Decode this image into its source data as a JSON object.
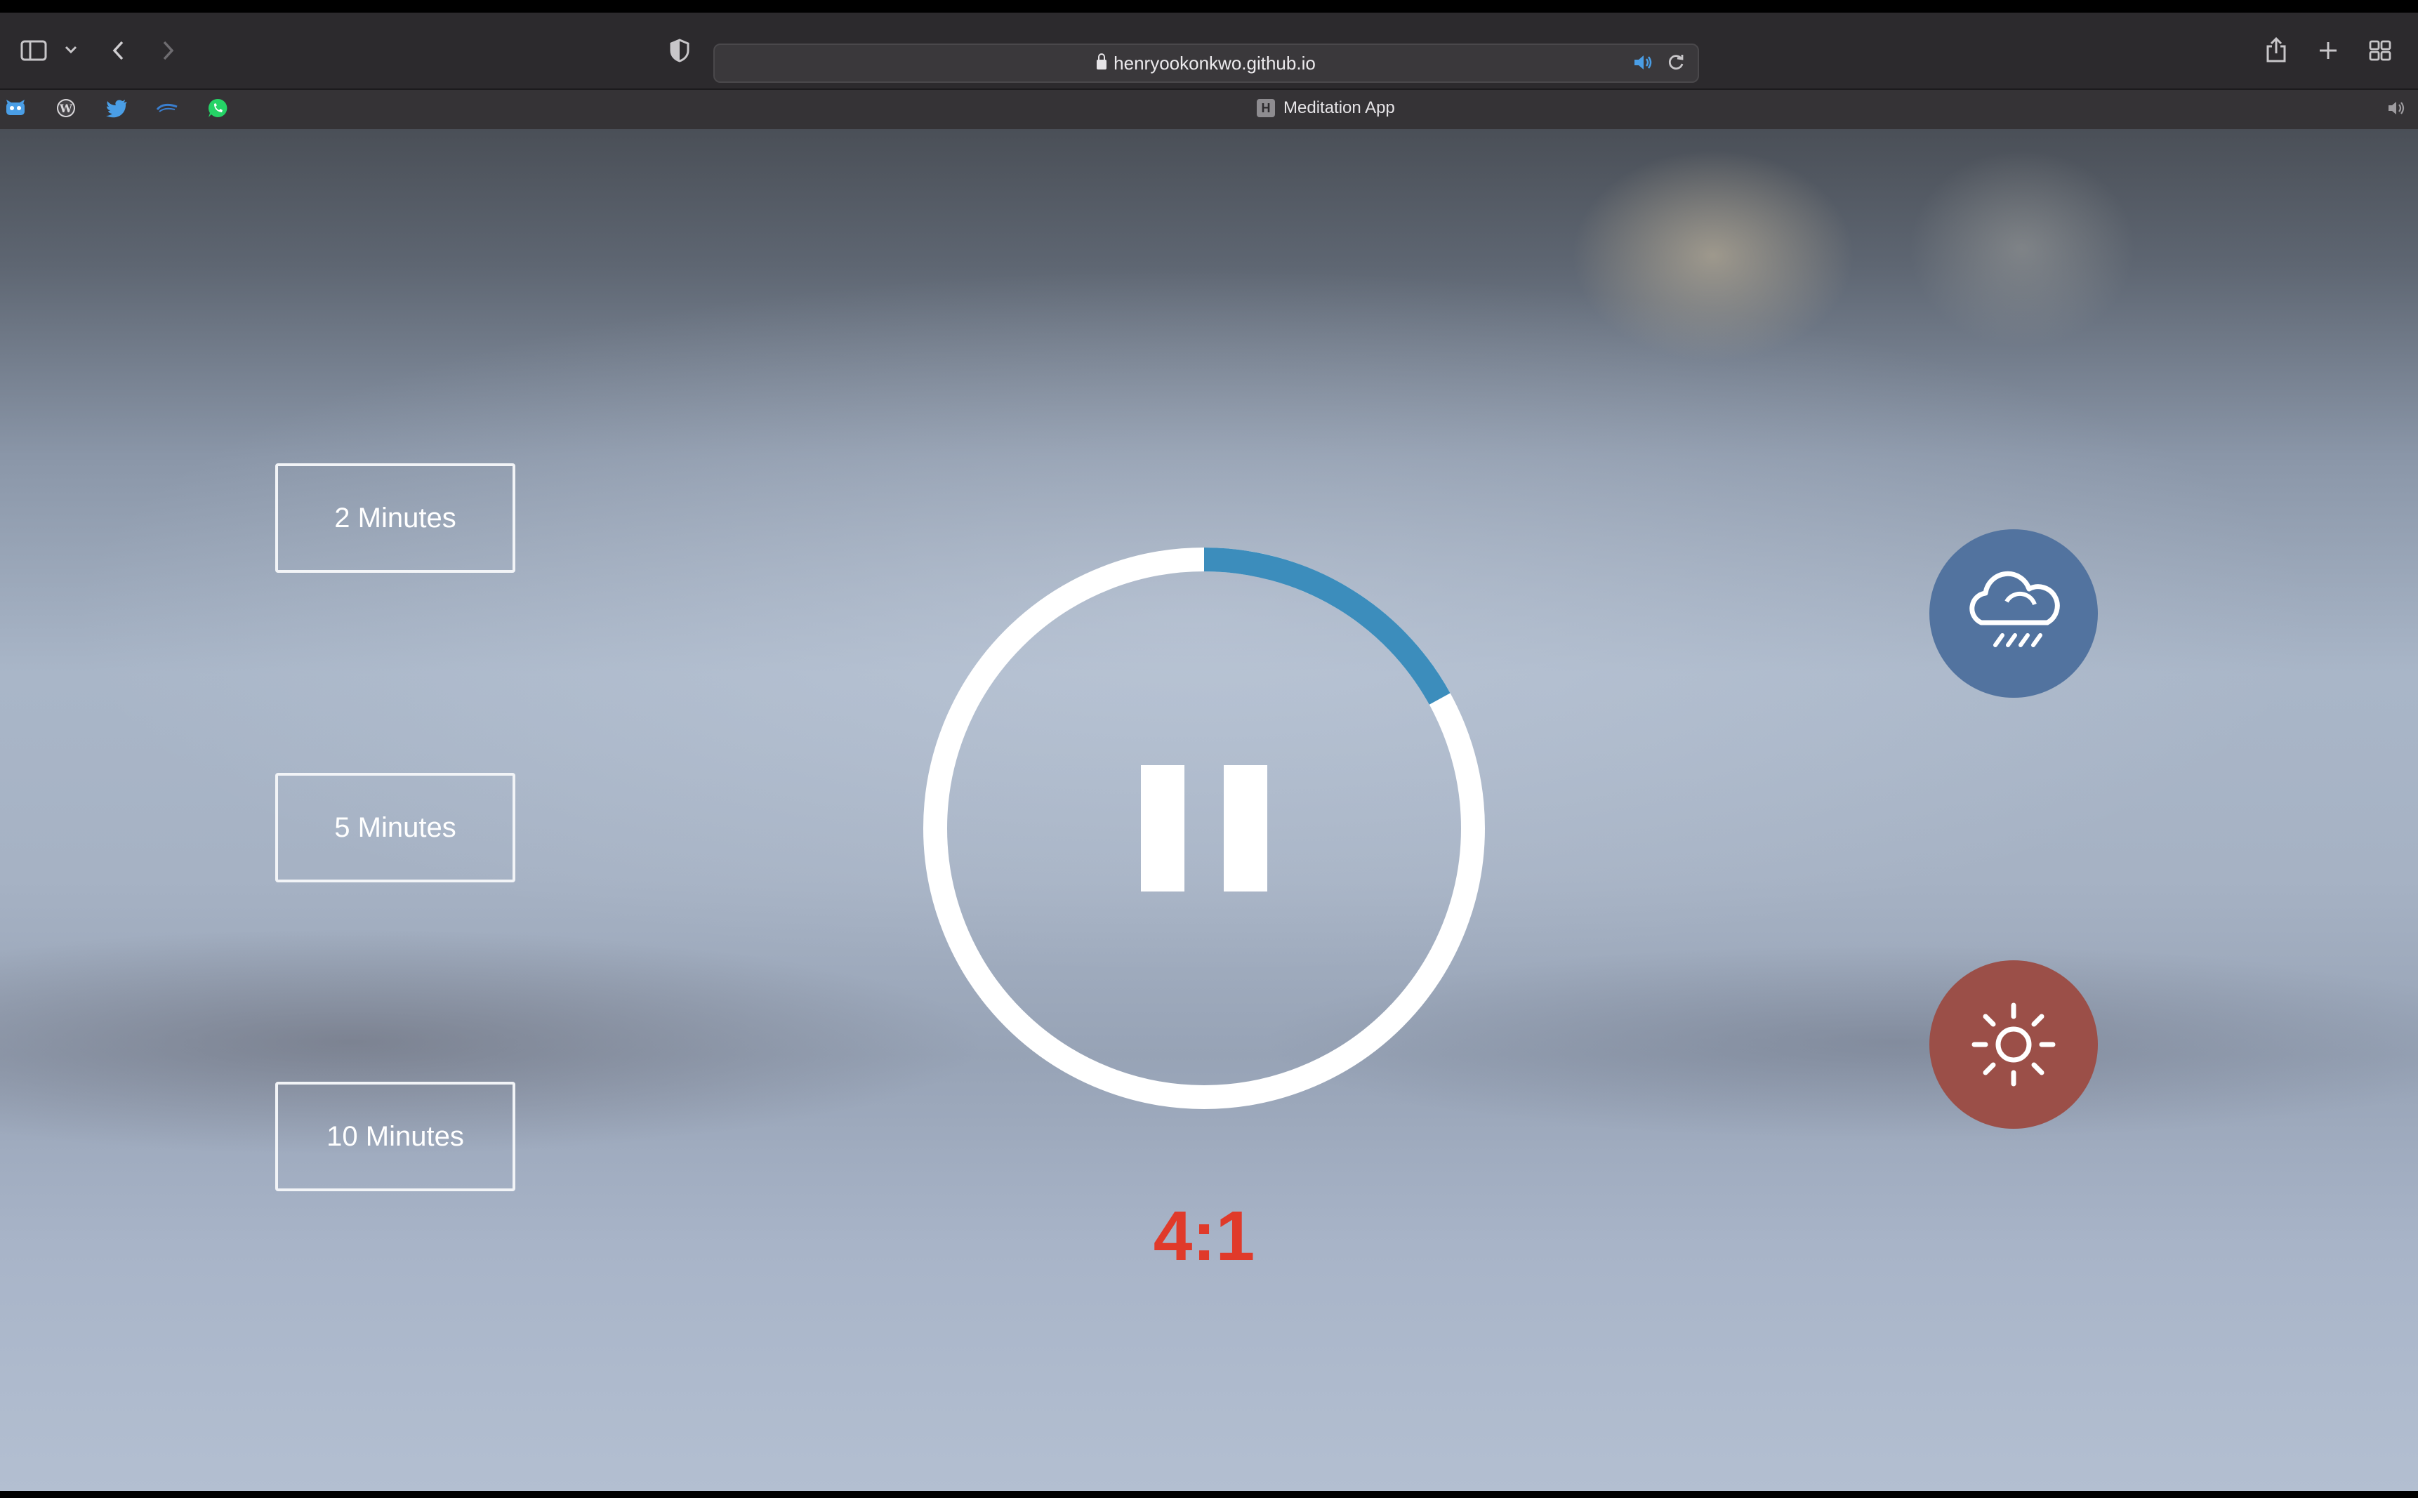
{
  "browser": {
    "url": "henryookonkwo.github.io",
    "tab": {
      "favicon_letter": "H",
      "title": "Meditation App"
    },
    "favorites": [
      "bitwarden-icon",
      "wordpress-icon",
      "twitter-icon",
      "link-icon",
      "whatsapp-icon"
    ]
  },
  "app": {
    "time_select": [
      {
        "label": "2 Minutes"
      },
      {
        "label": "5 Minutes"
      },
      {
        "label": "10 Minutes"
      }
    ],
    "player": {
      "state": "playing",
      "control_icon": "pause-icon",
      "progress": 0.17
    },
    "countdown": "4:1",
    "sounds": [
      {
        "name": "rain-icon",
        "color": "#52739f"
      },
      {
        "name": "sun-icon",
        "color": "#9b4f48"
      }
    ],
    "colors": {
      "progress_track": "#ffffff",
      "progress_fill": "#3c8dbc",
      "countdown": "#e03a2a"
    }
  }
}
